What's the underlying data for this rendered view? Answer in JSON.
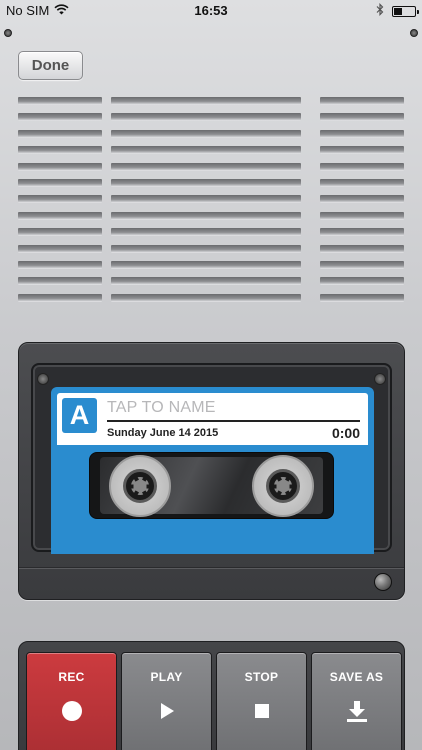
{
  "status_bar": {
    "carrier": "No SIM",
    "time": "16:53",
    "battery_level": 0.4
  },
  "header": {
    "done_label": "Done"
  },
  "cassette": {
    "side_letter": "A",
    "name_placeholder": "TAP TO NAME",
    "date": "Sunday June 14 2015",
    "duration": "0:00"
  },
  "controls": {
    "rec_label": "REC",
    "play_label": "PLAY",
    "stop_label": "STOP",
    "save_label": "SAVE AS"
  },
  "colors": {
    "accent_blue": "#2a8ccf",
    "record_red": "#b83338",
    "button_grey": "#7c7d80"
  },
  "icons": {
    "wifi": "wifi-icon",
    "bluetooth": "bluetooth-icon",
    "battery": "battery-icon",
    "record": "record-icon",
    "play": "play-icon",
    "stop": "stop-icon",
    "save": "download-icon"
  }
}
